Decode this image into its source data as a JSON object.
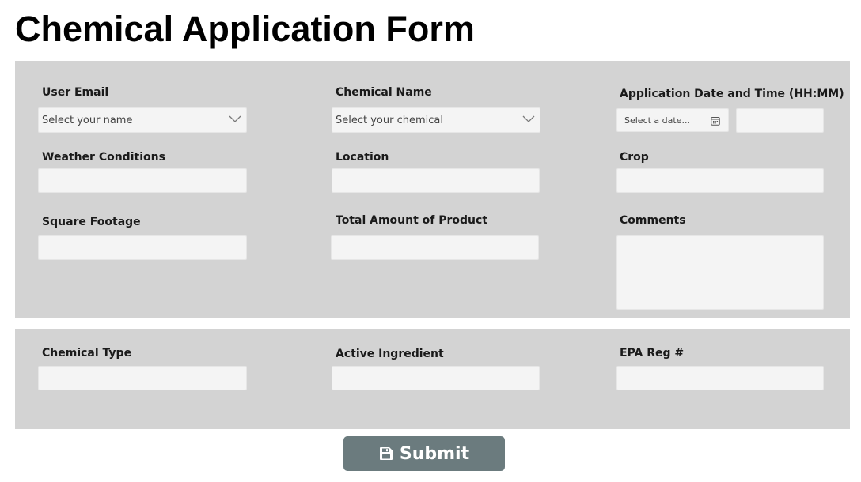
{
  "form": {
    "title": "Chemical Application Form",
    "submit_label": "Submit",
    "submit_color": "#6b7b7e",
    "panel_color": "#d3d3d3"
  },
  "fields": {
    "user_email": {
      "label": "User Email",
      "placeholder": "Select your name",
      "icon": "chevron-down-icon"
    },
    "chemical_name": {
      "label": "Chemical Name",
      "placeholder": "Select your chemical",
      "icon": "chevron-down-icon"
    },
    "application_datetime": {
      "label": "Application Date and Time (HH:MM)",
      "date_placeholder": "Select a date...",
      "date_icon": "calendar-icon",
      "time_value": ""
    },
    "weather_conditions": {
      "label": "Weather Conditions",
      "value": ""
    },
    "location": {
      "label": "Location",
      "value": ""
    },
    "crop": {
      "label": "Crop",
      "value": ""
    },
    "square_footage": {
      "label": "Square Footage",
      "value": ""
    },
    "total_amount": {
      "label": "Total Amount of Product",
      "value": ""
    },
    "comments": {
      "label": "Comments",
      "value": ""
    },
    "chemical_type": {
      "label": "Chemical Type",
      "value": ""
    },
    "active_ingredient": {
      "label": "Active Ingredient",
      "value": ""
    },
    "epa_reg": {
      "label": "EPA Reg #",
      "value": ""
    }
  }
}
